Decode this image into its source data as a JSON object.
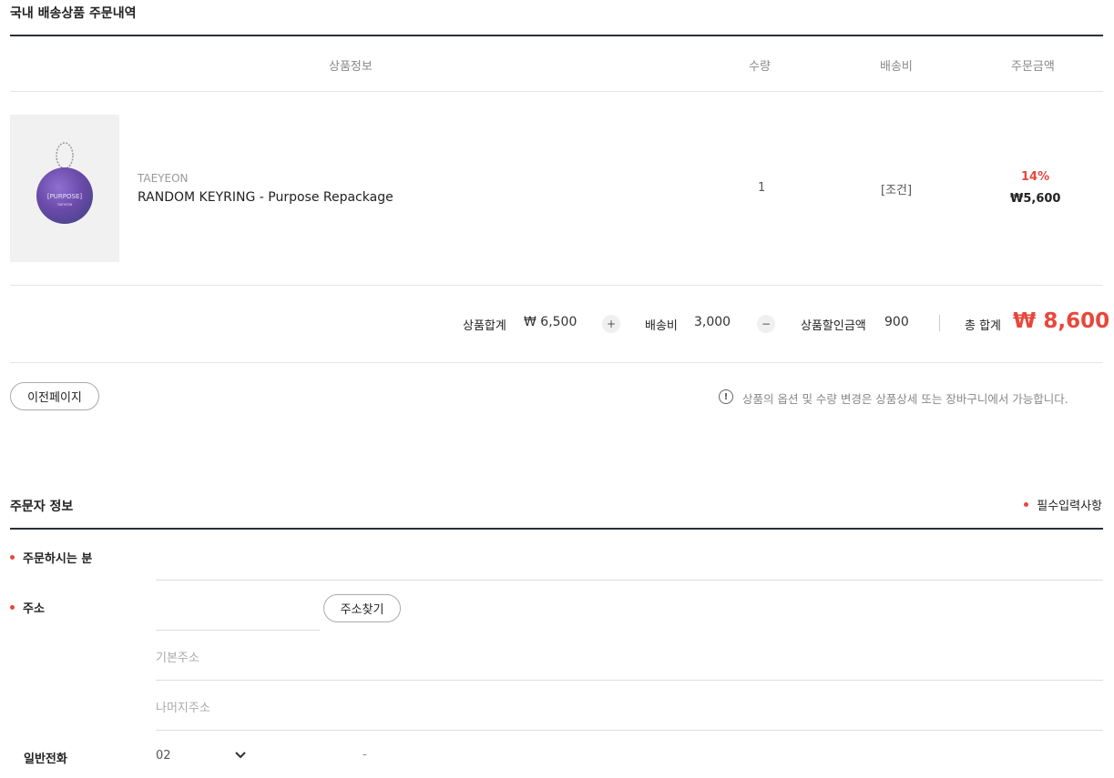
{
  "order_section": {
    "title": "국내 배송상품 주문내역",
    "headers": {
      "product": "상품정보",
      "qty": "수량",
      "shipping": "배송비",
      "amount": "주문금액"
    },
    "item": {
      "thumbnail_text_main": "[PURPOSE]",
      "thumbnail_text_sub": "TAEYEON",
      "brand": "TAEYEON",
      "name": "RANDOM KEYRING - Purpose Repackage",
      "qty": "1",
      "shipping": "[조건]",
      "discount": "14%",
      "price": "₩5,600"
    },
    "summary": {
      "subtotal_label": "상품합계",
      "subtotal_value": "₩ 6,500",
      "plus": "+",
      "shipping_label": "배송비",
      "shipping_value": "3,000",
      "minus": "−",
      "discount_label": "상품할인금액",
      "discount_value": "900",
      "total_label": "총 합계",
      "total_value": "₩ 8,600"
    },
    "prev_button": "이전페이지",
    "notice_icon": "!",
    "notice": "상품의 옵션 및 수량 변경은 상품상세 또는 장바구니에서 가능합니다."
  },
  "orderer_section": {
    "title": "주문자 정보",
    "required_note": "필수입력사항",
    "fields": {
      "name_label": "주문하시는 분",
      "address_label": "주소",
      "find_address_button": "주소찾기",
      "address_base_placeholder": "기본주소",
      "address_rest_placeholder": "나머지주소",
      "phone_label": "일반전화",
      "phone_area_code": "02",
      "phone_separator": "-"
    }
  },
  "colors": {
    "accent_red": "#e8473b",
    "dark_line": "#2b2f36"
  },
  "icons": [
    "keyring-thumbnail",
    "plus-icon",
    "minus-icon",
    "info-circle-icon",
    "chevron-down-icon"
  ]
}
